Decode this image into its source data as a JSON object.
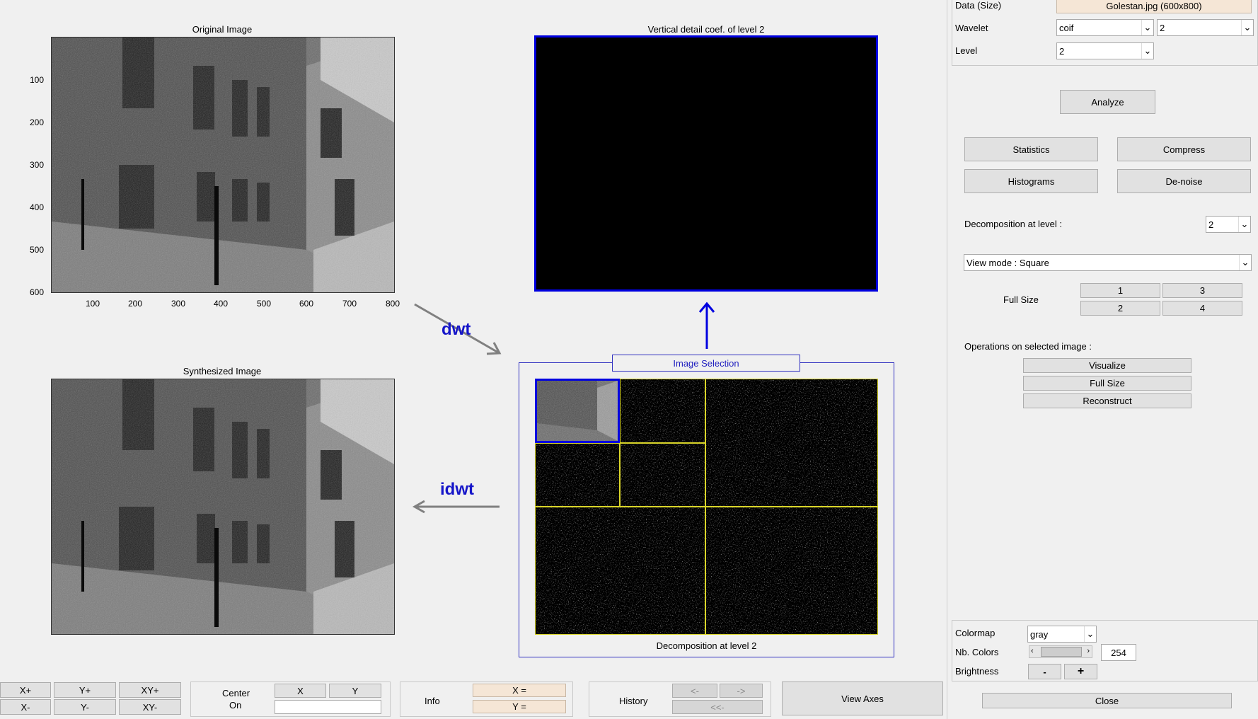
{
  "axes": {
    "original": {
      "title": "Original Image",
      "yticks": [
        "100",
        "200",
        "300",
        "400",
        "500",
        "600"
      ],
      "xticks": [
        "100",
        "200",
        "300",
        "400",
        "500",
        "600",
        "700",
        "800"
      ]
    },
    "vertical": {
      "title": "Vertical detail coef. of level 2"
    },
    "synth": {
      "title": "Synthesized Image"
    },
    "decomp": {
      "title": "Decomposition at level 2",
      "selection_label": "Image Selection"
    }
  },
  "arrows": {
    "dwt": "dwt",
    "idwt": "idwt"
  },
  "right_panel": {
    "data_label": "Data  (Size)",
    "data_value": "Golestan.jpg  (600x800)",
    "wavelet_label": "Wavelet",
    "wavelet_family": "coif",
    "wavelet_order": "2",
    "level_label": "Level",
    "level_value": "2",
    "analyze": "Analyze",
    "statistics": "Statistics",
    "compress": "Compress",
    "histograms": "Histograms",
    "denoise": "De-noise",
    "decomp_level_label": "Decomposition at level :",
    "decomp_level_value": "2",
    "view_mode": "View mode : Square",
    "full_size_label": "Full Size",
    "fs1": "1",
    "fs2": "2",
    "fs3": "3",
    "fs4": "4",
    "ops_label": "Operations on selected image :",
    "visualize": "Visualize",
    "full_size": "Full Size",
    "reconstruct": "Reconstruct",
    "colormap_label": "Colormap",
    "colormap_value": "gray",
    "nbcolors_label": "Nb. Colors",
    "nbcolors_value": "254",
    "brightness_label": "Brightness",
    "minus": "-",
    "plus": "+",
    "close": "Close"
  },
  "bottom": {
    "xplus": "X+",
    "yplus": "Y+",
    "xyplus": "XY+",
    "xminus": "X-",
    "yminus": "Y-",
    "xyminus": "XY-",
    "center": "Center",
    "on": "On",
    "x": "X",
    "y": "Y",
    "info": "Info",
    "info_x": "X =",
    "info_y": "Y =",
    "history": "History",
    "hist_back": "<-",
    "hist_fwd": "->",
    "hist_first": "<<-",
    "view_axes": "View Axes"
  }
}
